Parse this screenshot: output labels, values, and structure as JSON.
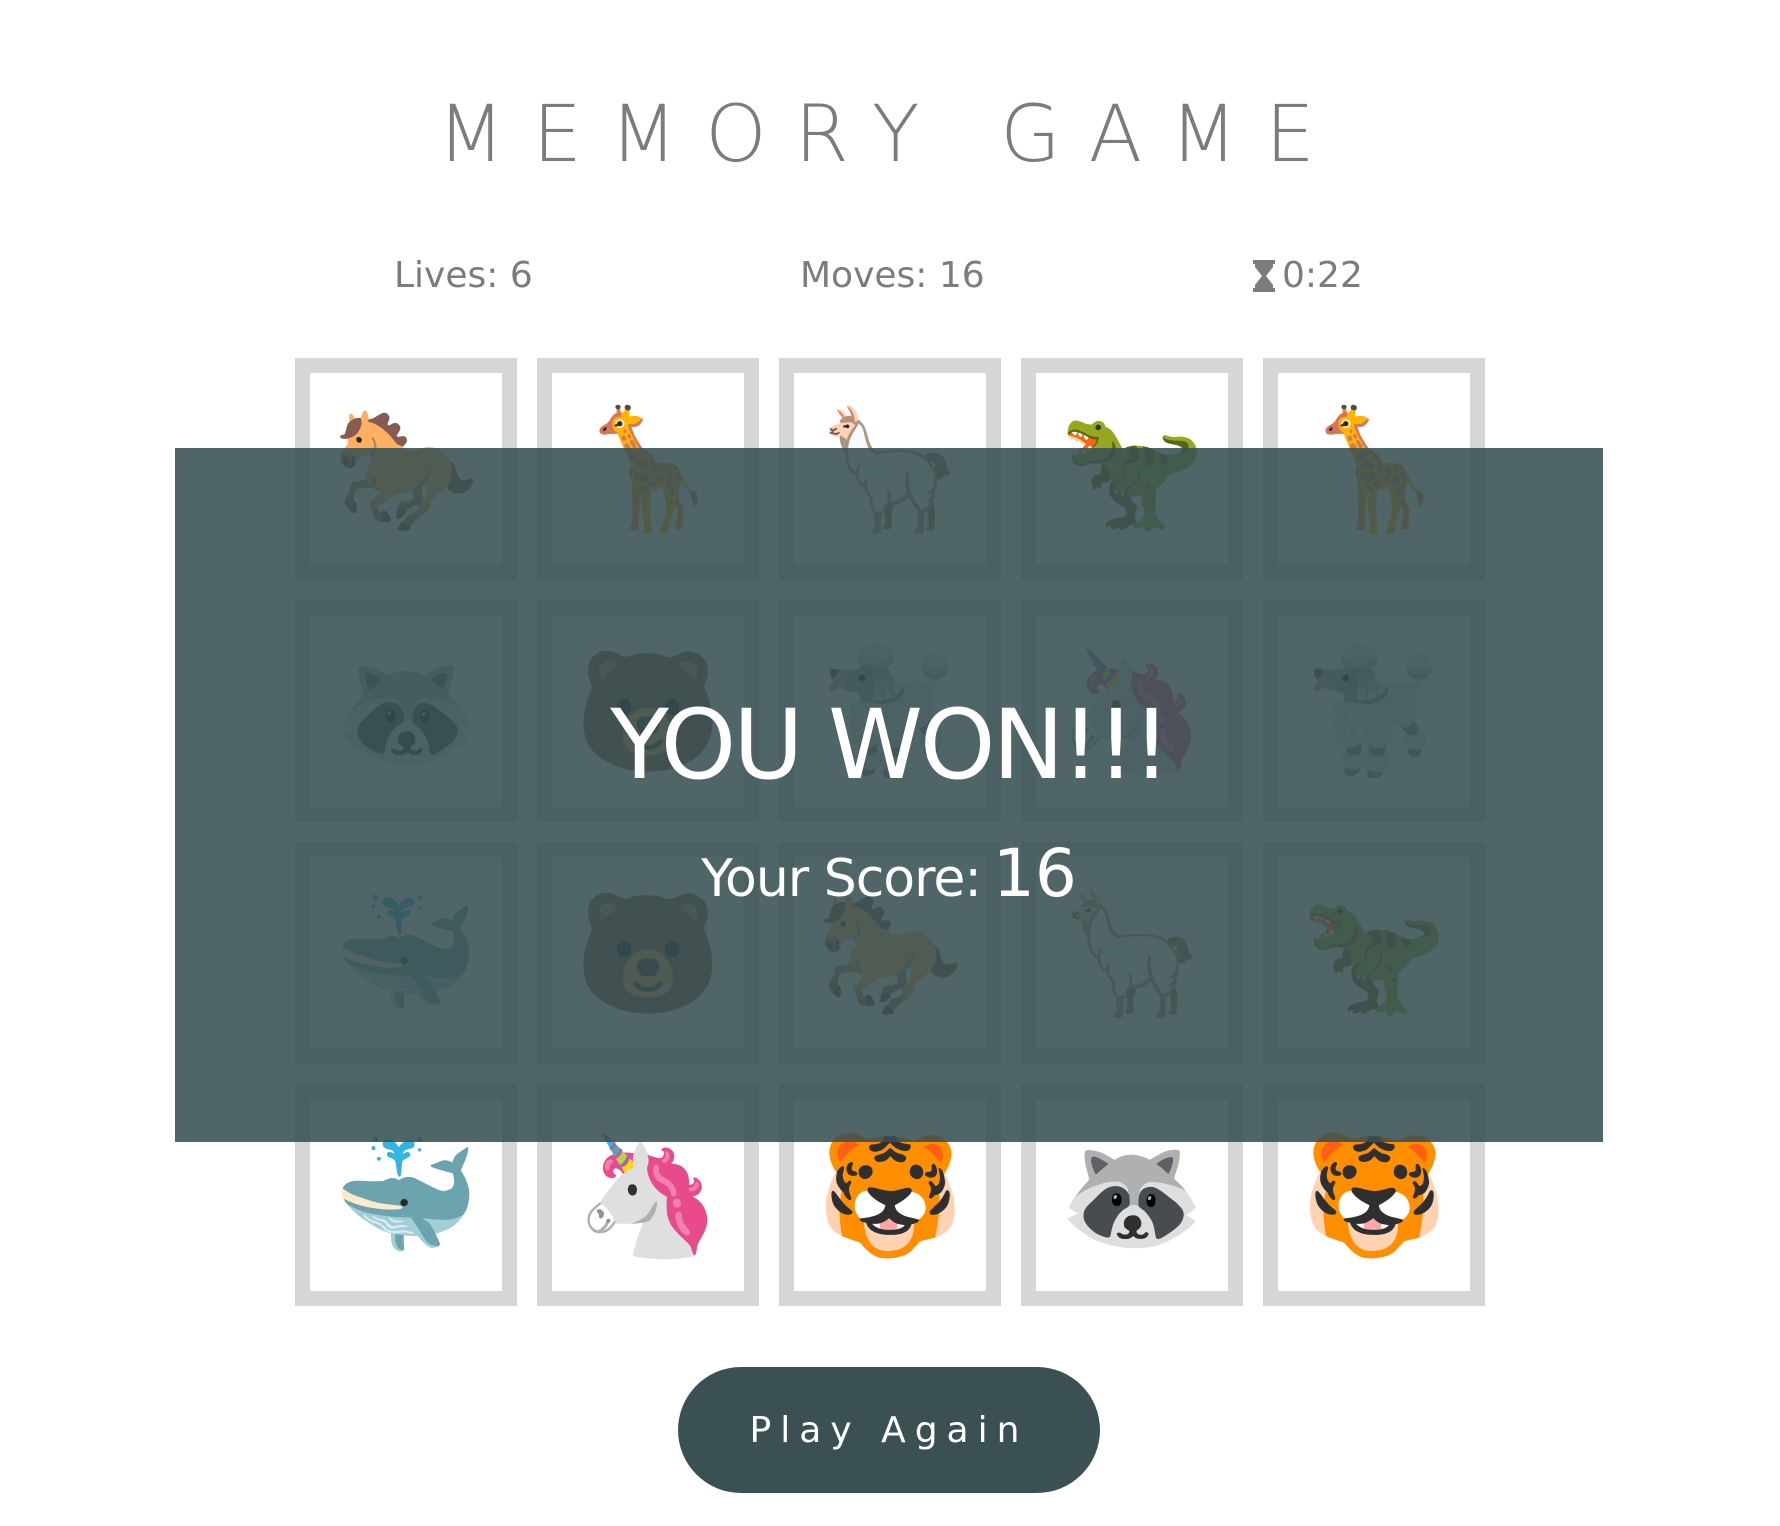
{
  "header": {
    "title": "MEMORY GAME"
  },
  "stats": {
    "lives": "Lives: 6",
    "moves": "Moves: 16",
    "timer": "0:22",
    "timer_icon": "hourglass-icon"
  },
  "cards": [
    {
      "emoji": "🐎",
      "name": "horse"
    },
    {
      "emoji": "🦒",
      "name": "giraffe"
    },
    {
      "emoji": "🦙",
      "name": "llama"
    },
    {
      "emoji": "🦖",
      "name": "t-rex"
    },
    {
      "emoji": "🦒",
      "name": "giraffe"
    },
    {
      "emoji": "🦝",
      "name": "raccoon"
    },
    {
      "emoji": "🐻",
      "name": "bear"
    },
    {
      "emoji": "🐩",
      "name": "poodle"
    },
    {
      "emoji": "🦄",
      "name": "unicorn"
    },
    {
      "emoji": "🐩",
      "name": "poodle"
    },
    {
      "emoji": "🐳",
      "name": "whale"
    },
    {
      "emoji": "🐻",
      "name": "bear"
    },
    {
      "emoji": "🐎",
      "name": "horse"
    },
    {
      "emoji": "🦙",
      "name": "llama"
    },
    {
      "emoji": "🦖",
      "name": "t-rex"
    },
    {
      "emoji": "🐳",
      "name": "whale"
    },
    {
      "emoji": "🦄",
      "name": "unicorn"
    },
    {
      "emoji": "🐯",
      "name": "tiger"
    },
    {
      "emoji": "🦝",
      "name": "raccoon"
    },
    {
      "emoji": "🐯",
      "name": "tiger"
    }
  ],
  "overlay": {
    "title": "YOU WON!!!",
    "score_label": "Your Score:",
    "score_value": "16"
  },
  "actions": {
    "play_again": "Play Again"
  },
  "colors": {
    "overlay": "#385052",
    "button": "#3a5052",
    "card_border": "#d6d6d6",
    "text_muted": "#7c7c7c"
  }
}
